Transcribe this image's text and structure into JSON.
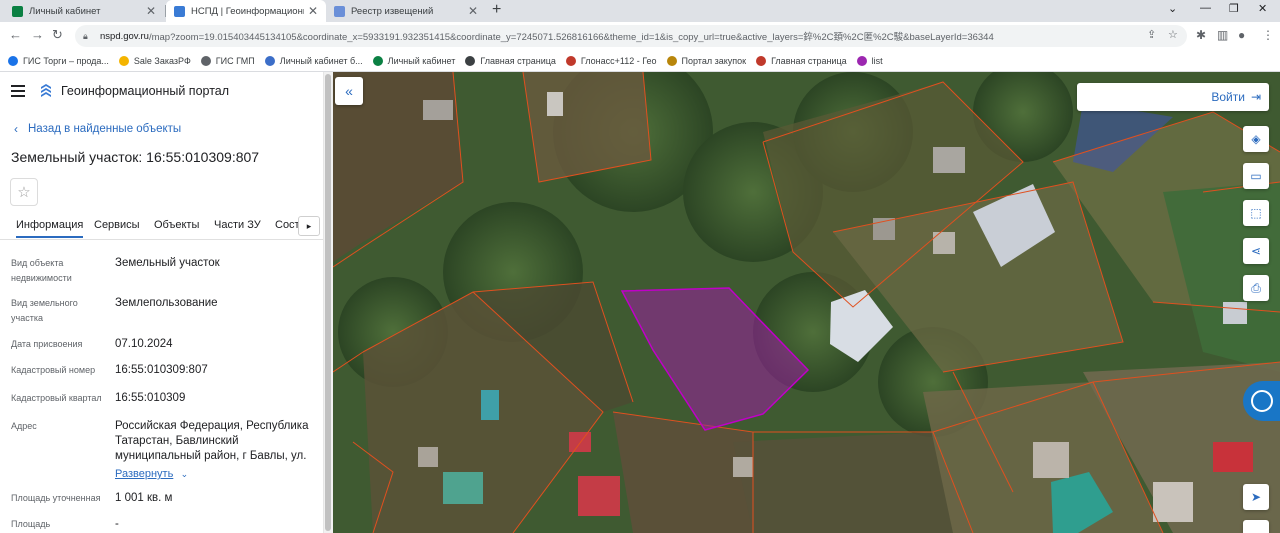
{
  "browser": {
    "tabs": [
      {
        "title": "Личный кабинет",
        "active": false
      },
      {
        "title": "НСПД | Геоинформационный п",
        "active": true
      },
      {
        "title": "Реестр извещений",
        "active": false
      }
    ],
    "url_host": "nspd.gov.ru",
    "url_rest": "/map?zoom=19.015403445134105&coordinate_x=5933191.932351415&coordinate_y=7245071.526816166&theme_id=1&is_copy_url=true&active_layers=錊%2C頚%2C匿%2C駿&baseLayerId=36344",
    "bookmarks": [
      {
        "label": "ГИС Торги – прода...",
        "color": "#1a73e8"
      },
      {
        "label": "Sale ЗаказРФ",
        "color": "#f4b400"
      },
      {
        "label": "ГИС ГМП",
        "color": "#5f6368"
      },
      {
        "label": "Личный кабинет б...",
        "color": "#3c6ec8"
      },
      {
        "label": "Личный кабинет",
        "color": "#0b8043"
      },
      {
        "label": "Главная страница",
        "color": "#3c4043"
      },
      {
        "label": "Глонасс+112 - Гео",
        "color": "#c0392b"
      },
      {
        "label": "Портал закупок",
        "color": "#b8860b"
      },
      {
        "label": "Главная страница",
        "color": "#c0392b"
      },
      {
        "label": "list",
        "color": "#9c27b0"
      }
    ]
  },
  "portal": {
    "title": "Геоинформационный портал",
    "back_label": "Назад в найденные объекты",
    "object_title": "Земельный участок: 16:55:010309:807",
    "tabs": [
      "Информация",
      "Сервисы",
      "Объекты",
      "Части ЗУ",
      "Соста"
    ],
    "active_tab": "Информация",
    "attributes": [
      {
        "label": "Вид объекта недвижимости",
        "value": "Земельный участок"
      },
      {
        "label": "Вид земельного участка",
        "value": "Землепользование"
      },
      {
        "label": "Дата присвоения",
        "value": "07.10.2024"
      },
      {
        "label": "Кадастровый номер",
        "value": "16:55:010309:807"
      },
      {
        "label": "Кадастровый квартал",
        "value": "16:55:010309"
      },
      {
        "label": "Адрес",
        "value": "Российская Федерация, Республика Татарстан, Бавлинский муниципальный район, г Бавлы, ул."
      },
      {
        "label": "Площадь уточненная",
        "value": "1 001 кв. м"
      },
      {
        "label": "Площадь",
        "value": "-"
      }
    ],
    "expand_label": "Развернуть"
  },
  "map": {
    "login_label": "Войти",
    "parcel_color": "#b000b0",
    "boundary_color": "#e0501f",
    "tools": [
      "layers-icon",
      "ruler-icon",
      "select-area-icon",
      "share-icon",
      "print-icon",
      "locate-icon"
    ]
  }
}
